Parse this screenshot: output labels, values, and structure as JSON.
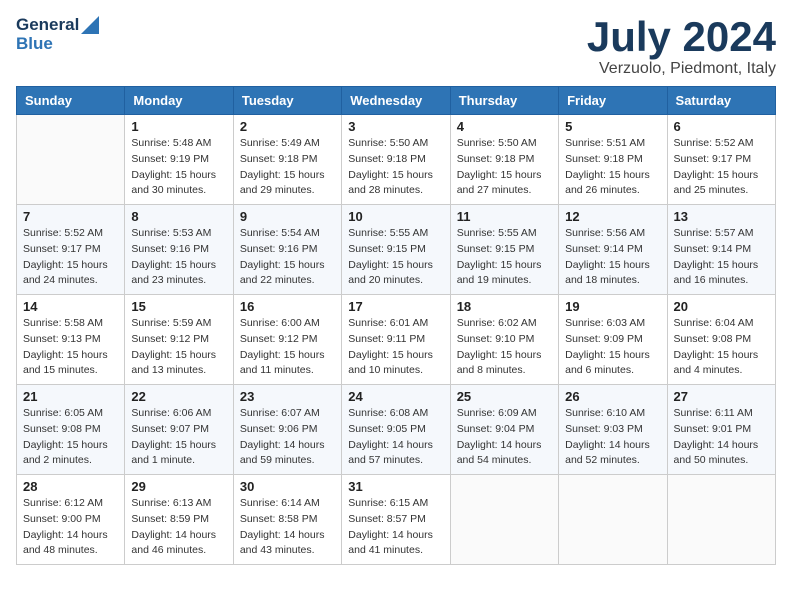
{
  "header": {
    "logo_line1": "General",
    "logo_line2": "Blue",
    "month": "July 2024",
    "location": "Verzuolo, Piedmont, Italy"
  },
  "weekdays": [
    "Sunday",
    "Monday",
    "Tuesday",
    "Wednesday",
    "Thursday",
    "Friday",
    "Saturday"
  ],
  "weeks": [
    [
      {
        "day": "",
        "sunrise": "",
        "sunset": "",
        "daylight": ""
      },
      {
        "day": "1",
        "sunrise": "Sunrise: 5:48 AM",
        "sunset": "Sunset: 9:19 PM",
        "daylight": "Daylight: 15 hours and 30 minutes."
      },
      {
        "day": "2",
        "sunrise": "Sunrise: 5:49 AM",
        "sunset": "Sunset: 9:18 PM",
        "daylight": "Daylight: 15 hours and 29 minutes."
      },
      {
        "day": "3",
        "sunrise": "Sunrise: 5:50 AM",
        "sunset": "Sunset: 9:18 PM",
        "daylight": "Daylight: 15 hours and 28 minutes."
      },
      {
        "day": "4",
        "sunrise": "Sunrise: 5:50 AM",
        "sunset": "Sunset: 9:18 PM",
        "daylight": "Daylight: 15 hours and 27 minutes."
      },
      {
        "day": "5",
        "sunrise": "Sunrise: 5:51 AM",
        "sunset": "Sunset: 9:18 PM",
        "daylight": "Daylight: 15 hours and 26 minutes."
      },
      {
        "day": "6",
        "sunrise": "Sunrise: 5:52 AM",
        "sunset": "Sunset: 9:17 PM",
        "daylight": "Daylight: 15 hours and 25 minutes."
      }
    ],
    [
      {
        "day": "7",
        "sunrise": "Sunrise: 5:52 AM",
        "sunset": "Sunset: 9:17 PM",
        "daylight": "Daylight: 15 hours and 24 minutes."
      },
      {
        "day": "8",
        "sunrise": "Sunrise: 5:53 AM",
        "sunset": "Sunset: 9:16 PM",
        "daylight": "Daylight: 15 hours and 23 minutes."
      },
      {
        "day": "9",
        "sunrise": "Sunrise: 5:54 AM",
        "sunset": "Sunset: 9:16 PM",
        "daylight": "Daylight: 15 hours and 22 minutes."
      },
      {
        "day": "10",
        "sunrise": "Sunrise: 5:55 AM",
        "sunset": "Sunset: 9:15 PM",
        "daylight": "Daylight: 15 hours and 20 minutes."
      },
      {
        "day": "11",
        "sunrise": "Sunrise: 5:55 AM",
        "sunset": "Sunset: 9:15 PM",
        "daylight": "Daylight: 15 hours and 19 minutes."
      },
      {
        "day": "12",
        "sunrise": "Sunrise: 5:56 AM",
        "sunset": "Sunset: 9:14 PM",
        "daylight": "Daylight: 15 hours and 18 minutes."
      },
      {
        "day": "13",
        "sunrise": "Sunrise: 5:57 AM",
        "sunset": "Sunset: 9:14 PM",
        "daylight": "Daylight: 15 hours and 16 minutes."
      }
    ],
    [
      {
        "day": "14",
        "sunrise": "Sunrise: 5:58 AM",
        "sunset": "Sunset: 9:13 PM",
        "daylight": "Daylight: 15 hours and 15 minutes."
      },
      {
        "day": "15",
        "sunrise": "Sunrise: 5:59 AM",
        "sunset": "Sunset: 9:12 PM",
        "daylight": "Daylight: 15 hours and 13 minutes."
      },
      {
        "day": "16",
        "sunrise": "Sunrise: 6:00 AM",
        "sunset": "Sunset: 9:12 PM",
        "daylight": "Daylight: 15 hours and 11 minutes."
      },
      {
        "day": "17",
        "sunrise": "Sunrise: 6:01 AM",
        "sunset": "Sunset: 9:11 PM",
        "daylight": "Daylight: 15 hours and 10 minutes."
      },
      {
        "day": "18",
        "sunrise": "Sunrise: 6:02 AM",
        "sunset": "Sunset: 9:10 PM",
        "daylight": "Daylight: 15 hours and 8 minutes."
      },
      {
        "day": "19",
        "sunrise": "Sunrise: 6:03 AM",
        "sunset": "Sunset: 9:09 PM",
        "daylight": "Daylight: 15 hours and 6 minutes."
      },
      {
        "day": "20",
        "sunrise": "Sunrise: 6:04 AM",
        "sunset": "Sunset: 9:08 PM",
        "daylight": "Daylight: 15 hours and 4 minutes."
      }
    ],
    [
      {
        "day": "21",
        "sunrise": "Sunrise: 6:05 AM",
        "sunset": "Sunset: 9:08 PM",
        "daylight": "Daylight: 15 hours and 2 minutes."
      },
      {
        "day": "22",
        "sunrise": "Sunrise: 6:06 AM",
        "sunset": "Sunset: 9:07 PM",
        "daylight": "Daylight: 15 hours and 1 minute."
      },
      {
        "day": "23",
        "sunrise": "Sunrise: 6:07 AM",
        "sunset": "Sunset: 9:06 PM",
        "daylight": "Daylight: 14 hours and 59 minutes."
      },
      {
        "day": "24",
        "sunrise": "Sunrise: 6:08 AM",
        "sunset": "Sunset: 9:05 PM",
        "daylight": "Daylight: 14 hours and 57 minutes."
      },
      {
        "day": "25",
        "sunrise": "Sunrise: 6:09 AM",
        "sunset": "Sunset: 9:04 PM",
        "daylight": "Daylight: 14 hours and 54 minutes."
      },
      {
        "day": "26",
        "sunrise": "Sunrise: 6:10 AM",
        "sunset": "Sunset: 9:03 PM",
        "daylight": "Daylight: 14 hours and 52 minutes."
      },
      {
        "day": "27",
        "sunrise": "Sunrise: 6:11 AM",
        "sunset": "Sunset: 9:01 PM",
        "daylight": "Daylight: 14 hours and 50 minutes."
      }
    ],
    [
      {
        "day": "28",
        "sunrise": "Sunrise: 6:12 AM",
        "sunset": "Sunset: 9:00 PM",
        "daylight": "Daylight: 14 hours and 48 minutes."
      },
      {
        "day": "29",
        "sunrise": "Sunrise: 6:13 AM",
        "sunset": "Sunset: 8:59 PM",
        "daylight": "Daylight: 14 hours and 46 minutes."
      },
      {
        "day": "30",
        "sunrise": "Sunrise: 6:14 AM",
        "sunset": "Sunset: 8:58 PM",
        "daylight": "Daylight: 14 hours and 43 minutes."
      },
      {
        "day": "31",
        "sunrise": "Sunrise: 6:15 AM",
        "sunset": "Sunset: 8:57 PM",
        "daylight": "Daylight: 14 hours and 41 minutes."
      },
      {
        "day": "",
        "sunrise": "",
        "sunset": "",
        "daylight": ""
      },
      {
        "day": "",
        "sunrise": "",
        "sunset": "",
        "daylight": ""
      },
      {
        "day": "",
        "sunrise": "",
        "sunset": "",
        "daylight": ""
      }
    ]
  ]
}
